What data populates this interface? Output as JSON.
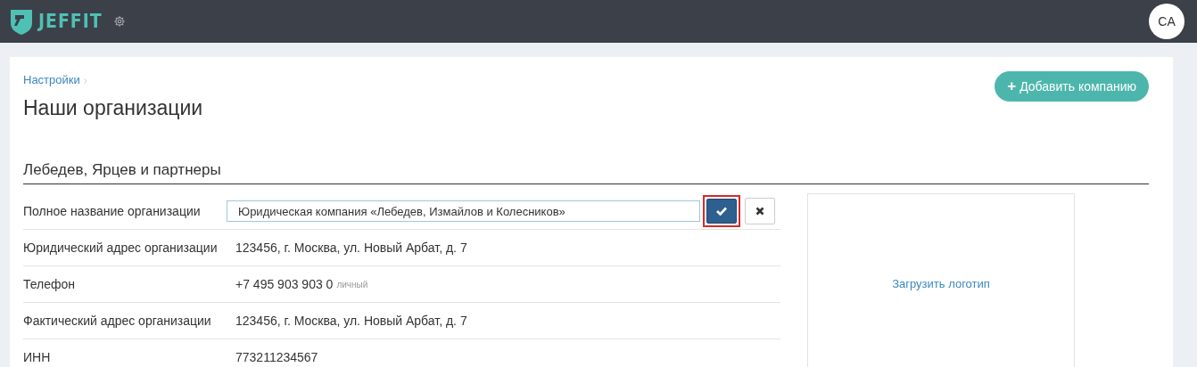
{
  "header": {
    "brand": "JEFFIT",
    "avatar": "CA"
  },
  "breadcrumb": [
    "Настройки"
  ],
  "title": "Наши организации",
  "add_button": {
    "icon": "+",
    "label": "Добавить компанию"
  },
  "company": {
    "name": "Лебедев, Ярцев и партнеры",
    "fields": [
      {
        "kind": "edit",
        "label": "Полное название организации",
        "value": "Юридическая компания «Лебедев, Измайлов и Колесников»",
        "save_highlighted": true
      },
      {
        "kind": "text",
        "label": "Юридический адрес организации",
        "value": "123456, г. Москва, ул. Новый Арбат, д. 7"
      },
      {
        "kind": "text",
        "label": "Телефон",
        "value": "+7 495 903 903 0",
        "note": "личный"
      },
      {
        "kind": "text",
        "label": "Фактический адрес организации",
        "value": "123456, г. Москва, ул. Новый Арбат, д. 7"
      },
      {
        "kind": "text",
        "label": "ИНН",
        "value": "773211234567"
      }
    ],
    "logo_link": "Загрузить логотип"
  }
}
